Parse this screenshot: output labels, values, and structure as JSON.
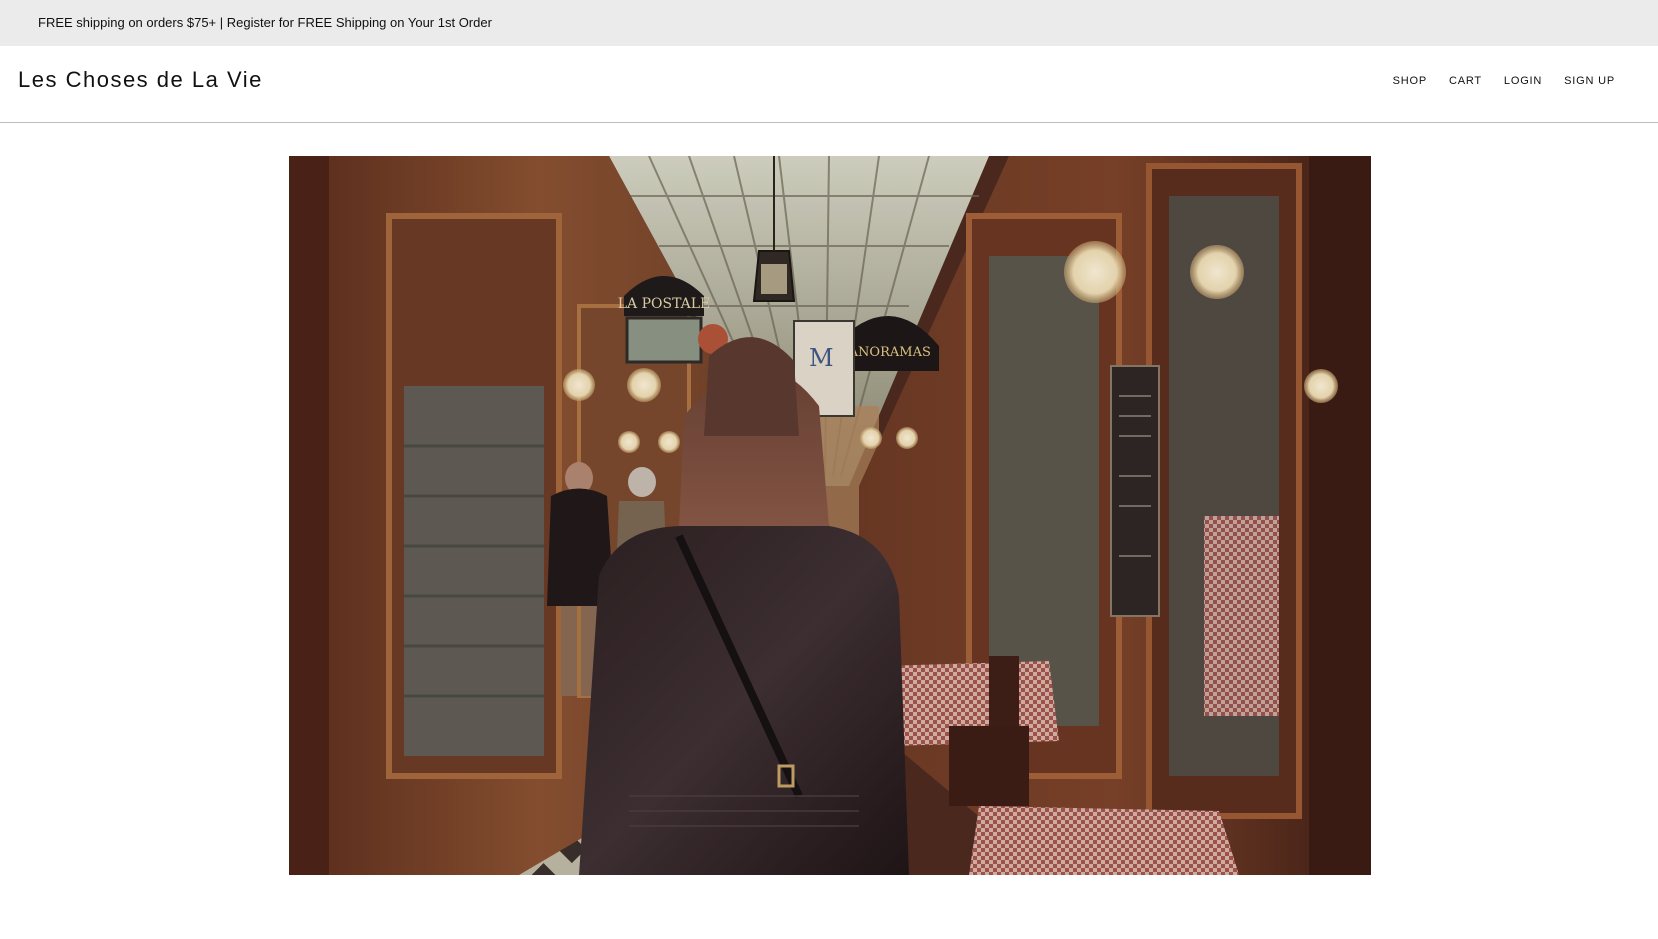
{
  "announcement": {
    "text": "FREE shipping on orders $75+ | Register for FREE Shipping on Your 1st Order"
  },
  "header": {
    "logo": "Les Choses de La Vie",
    "nav": [
      {
        "label": "SHOP"
      },
      {
        "label": "CART"
      },
      {
        "label": "LOGIN"
      },
      {
        "label": "SIGN UP"
      }
    ]
  },
  "hero": {
    "image": "photo-paris-covered-passage-woman-leather-jacket",
    "signs": {
      "left": "LA POSTALE",
      "center": "PANORAMAS"
    }
  },
  "colors": {
    "announcement_bg": "#ebebeb",
    "header_border": "#bdbdbd",
    "text": "#111111"
  }
}
